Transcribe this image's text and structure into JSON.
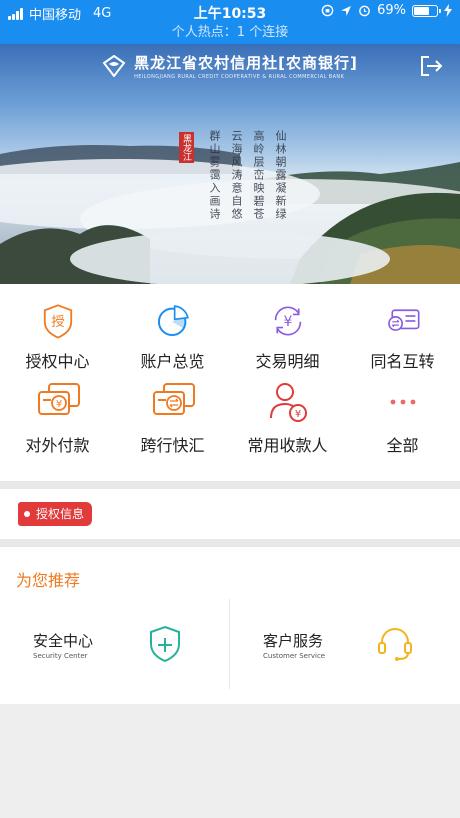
{
  "status_bar": {
    "carrier": "中国移动",
    "network": "4G",
    "time": "上午10:53",
    "battery": "69%",
    "battery_level": 0.69
  },
  "hotspot_text": "个人热点：1 个连接",
  "banner": {
    "bank_name_cn": "黑龙江省农村信用社[农商银行]",
    "bank_name_en": "HEILONGJIANG RURAL CREDIT COOPERATIVE & RURAL COMMERCIAL BANK",
    "logout_icon": "logout-icon",
    "seal_text": "黑龙江",
    "poem_lines": [
      "仙林朝露凝新绿",
      "高岭层峦映碧苍",
      "云海风涛意自悠",
      "群山雾霭入画诗"
    ]
  },
  "quick_functions": [
    {
      "label": "授权中心",
      "icon": "authorize-icon",
      "icon_char": "授",
      "color": "#f07a22"
    },
    {
      "label": "账户总览",
      "icon": "pie-chart-icon",
      "color": "#1a8ef0"
    },
    {
      "label": "交易明细",
      "icon": "yuan-refresh-icon",
      "icon_char": "¥",
      "color": "#8a5ce0"
    },
    {
      "label": "同名互转",
      "icon": "card-transfer-icon",
      "color": "#8a5ce0"
    },
    {
      "label": "对外付款",
      "icon": "card-yuan-icon",
      "icon_char": "¥",
      "color": "#f07a22"
    },
    {
      "label": "跨行快汇",
      "icon": "card-exchange-icon",
      "color": "#f07a22"
    },
    {
      "label": "常用收款人",
      "icon": "payee-icon",
      "icon_char": "¥",
      "color": "#e03a3a"
    },
    {
      "label": "全部",
      "icon": "more-dots-icon",
      "color": "#e66"
    }
  ],
  "auth_info_tag": "授权信息",
  "recommend": {
    "title": "为您推荐",
    "items": [
      {
        "cn": "安全中心",
        "en": "Security Center",
        "icon": "shield-plus-icon",
        "color": "#26b39a"
      },
      {
        "cn": "客户服务",
        "en": "Customer Service",
        "icon": "headset-icon",
        "color": "#f2b51d"
      }
    ]
  }
}
